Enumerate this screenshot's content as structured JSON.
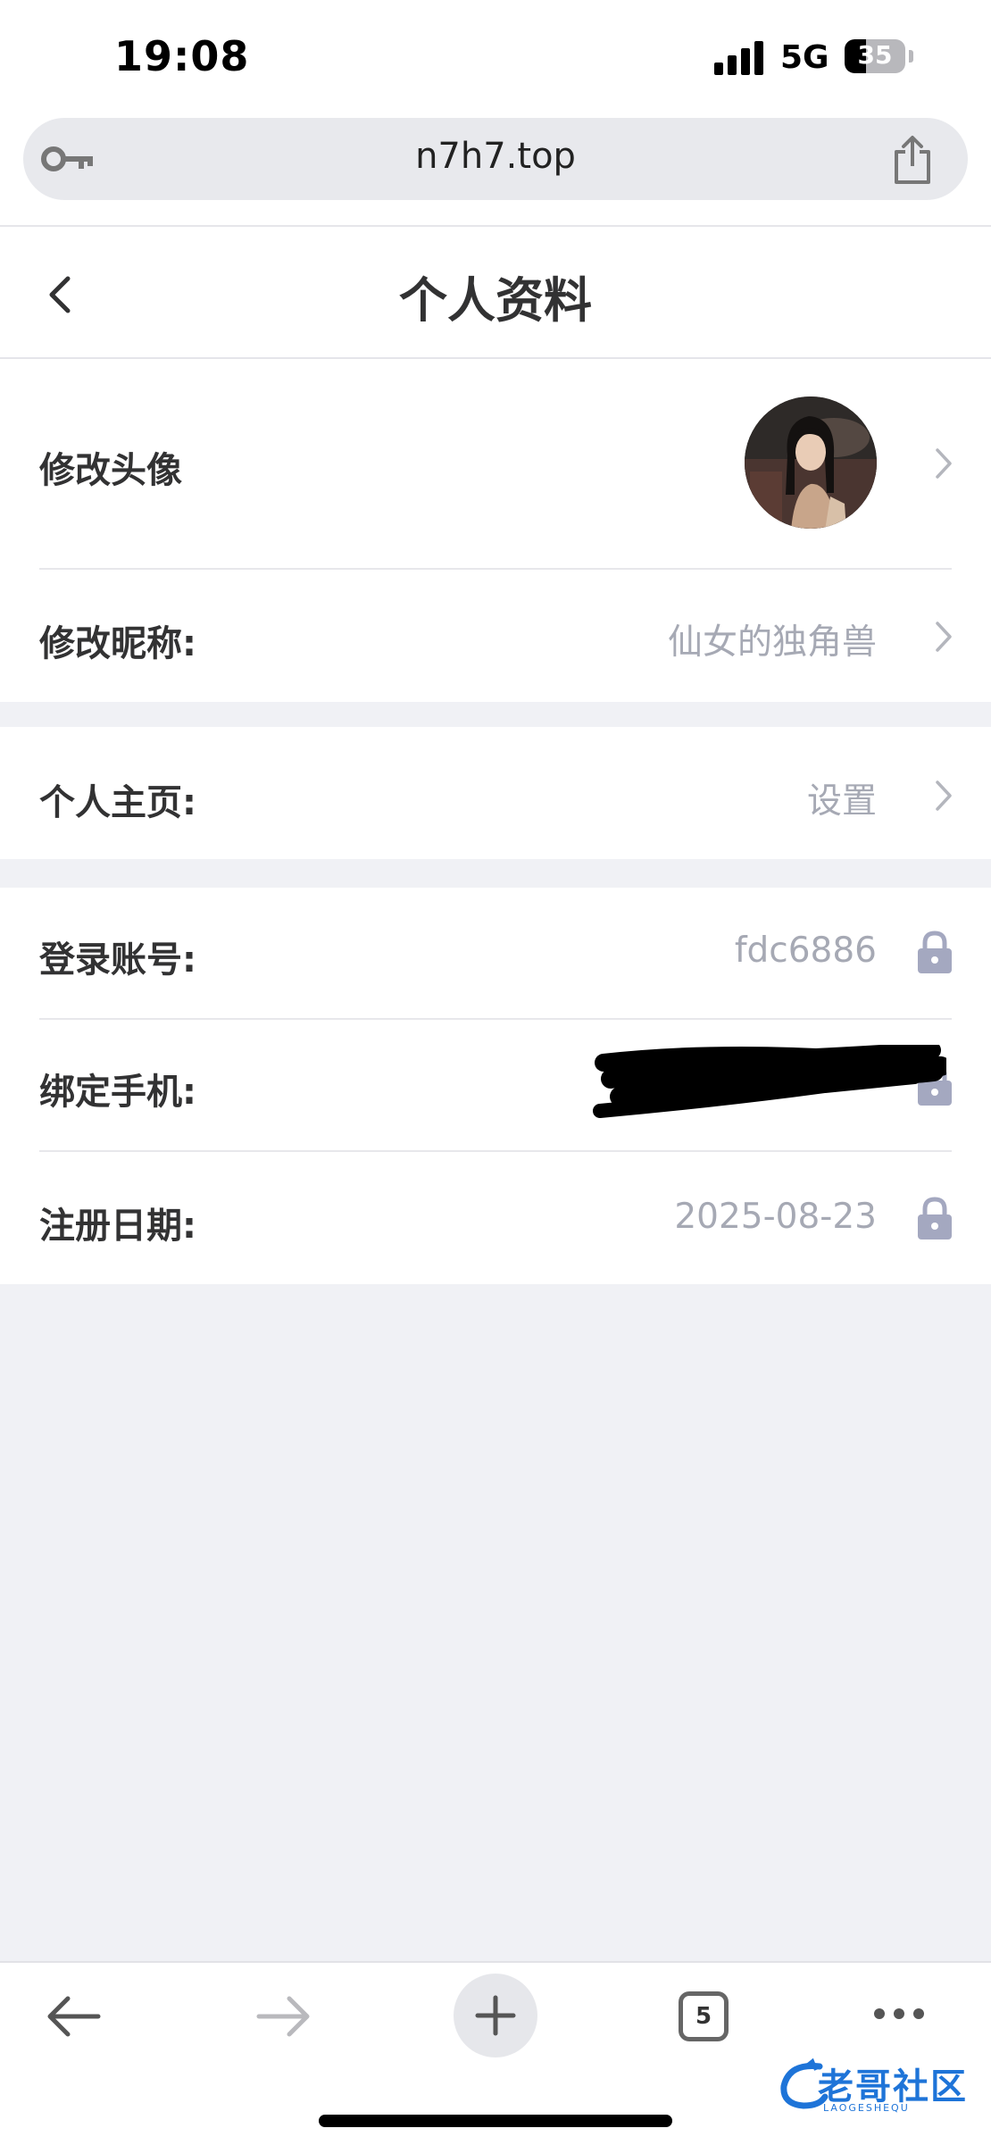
{
  "status_bar": {
    "time": "19:08",
    "network": "5G",
    "battery": "35",
    "battery_level": 0.35
  },
  "browser": {
    "url": "n7h7.top",
    "tab_count": "5"
  },
  "page": {
    "title": "个人资料"
  },
  "profile": {
    "avatar_label": "修改头像",
    "nickname_label": "修改昵称:",
    "nickname_value": "仙女的独角兽",
    "homepage_label": "个人主页:",
    "homepage_value": "设置",
    "account_label": "登录账号:",
    "account_value": "fdc6886",
    "phone_label": "绑定手机:",
    "phone_value": "",
    "register_label": "注册日期:",
    "register_value": "2025-08-23"
  },
  "watermark": {
    "text": "老哥社区",
    "sub": "LAOGESHEQU"
  },
  "colors": {
    "accent_text": "#323233",
    "muted_text": "#a6a9b4",
    "background": "#f0f1f5",
    "lock": "#a4a8c0"
  },
  "icons": [
    "key-icon",
    "share-icon",
    "back-icon",
    "chevron-right-icon",
    "lock-icon",
    "arrow-left-icon",
    "arrow-right-icon",
    "plus-icon",
    "tabs-icon",
    "more-icon"
  ]
}
